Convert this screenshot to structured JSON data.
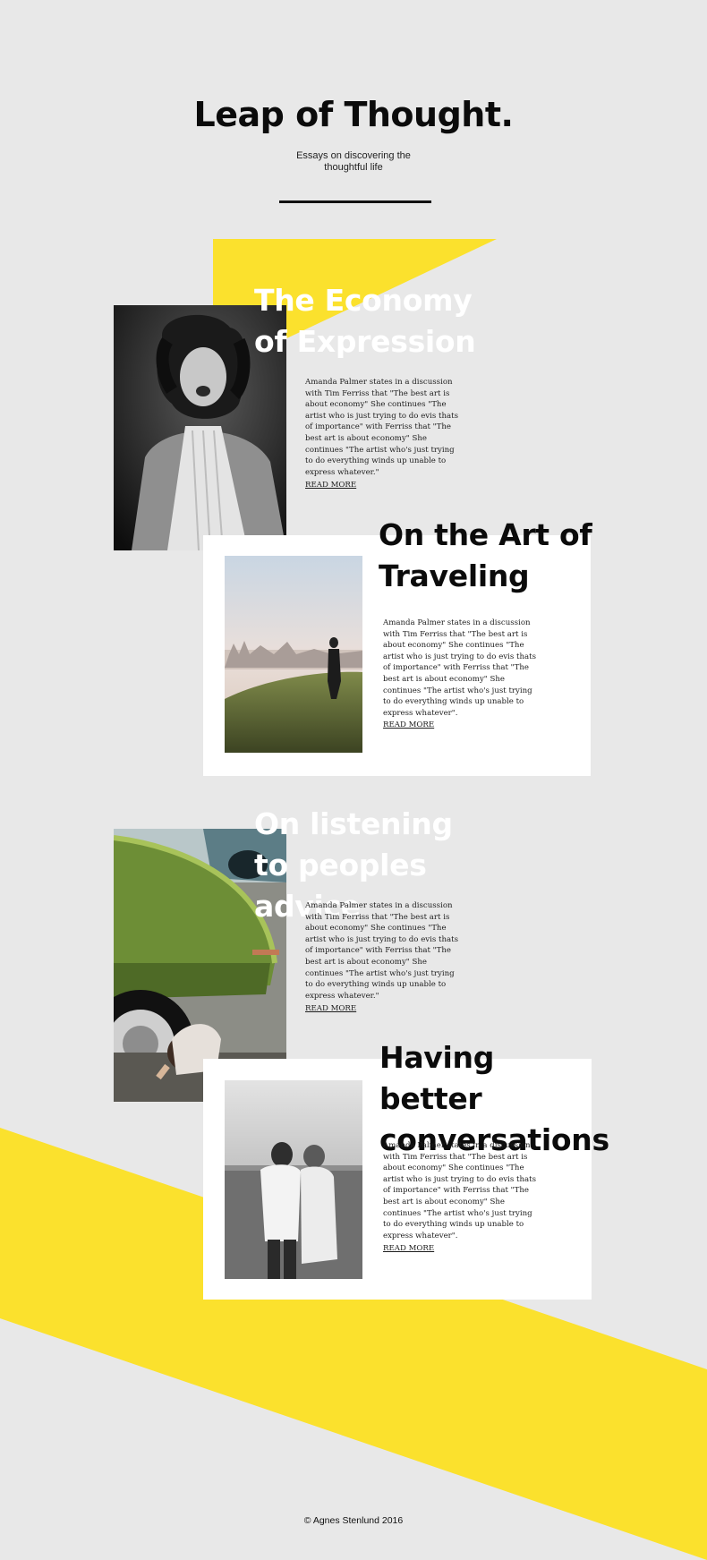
{
  "header": {
    "title": "Leap of Thought.",
    "subtitle": "Essays on discovering the thoughtful life"
  },
  "articles": [
    {
      "title": "The Economy of Expression",
      "body": "Amanda Palmer states in a discussion with Tim Ferriss that \"The best art is about economy\" She continues \"The artist who is just trying to do evis thats of importance\" with Ferriss that \"The best art is about economy\" She continues \"The artist who's just trying to do everything winds up unable to express whatever.\"",
      "read_more": "READ MORE",
      "image": "bw-portrait-girl-photo"
    },
    {
      "title": "On the Art of Traveling",
      "body": "Amanda Palmer states in a discussion with Tim Ferriss that \"The best art is about economy\" She continues \"The artist who is just trying to do evis thats of importance\" with Ferriss that \"The best art is about economy\" She continues \"The artist who's just trying to do everything winds up unable to express whatever\".",
      "read_more": "READ MORE",
      "image": "hillside-city-view-photo"
    },
    {
      "title": "On listening to peoples advice",
      "body": "Amanda Palmer states in a discussion with Tim Ferriss that \"The best art is about economy\" She continues \"The artist who is just trying to do evis thats of importance\" with Ferriss that \"The best art is about economy\" She continues \"The artist who's just trying to do everything winds up unable to express whatever.\"",
      "read_more": "READ MORE",
      "image": "green-car-child-photo"
    },
    {
      "title": "Having better conversations",
      "body": "Amanda Palmer states in a discussion with Tim Ferriss that \"The best art is about economy\" She continues \"The artist who is just trying to do evis thats of importance\" with Ferriss that \"The best art is about economy\" She continues \"The artist who's just trying to do everything winds up unable to express whatever\".",
      "read_more": "READ MORE",
      "image": "bw-couple-embrace-photo"
    }
  ],
  "footer": {
    "copyright": "© Agnes Stenlund 2016"
  },
  "colors": {
    "background": "#e8e8e8",
    "accent_yellow": "#fbe12d",
    "card": "#ffffff",
    "text": "#111111"
  }
}
